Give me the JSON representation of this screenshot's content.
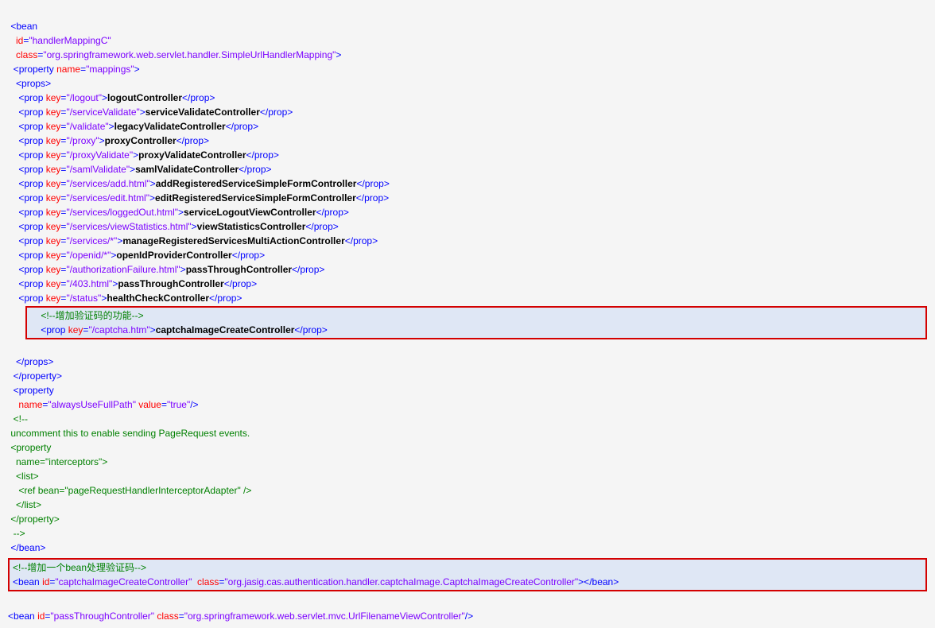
{
  "bean1": {
    "tag": "bean",
    "idAttr": "id",
    "idVal": "\"handlerMappingC\"",
    "classAttr": "class",
    "classVal": "\"org.springframework.web.servlet.handler.SimpleUrlHandlerMapping\""
  },
  "prop1": {
    "tag": "property",
    "nameAttr": "name",
    "nameVal": "\"mappings\""
  },
  "propsTag": "props",
  "props": [
    {
      "key": "\"/logout\"",
      "val": "logoutController"
    },
    {
      "key": "\"/serviceValidate\"",
      "val": "serviceValidateController"
    },
    {
      "key": "\"/validate\"",
      "val": "legacyValidateController"
    },
    {
      "key": "\"/proxy\"",
      "val": "proxyController"
    },
    {
      "key": "\"/proxyValidate\"",
      "val": "proxyValidateController"
    },
    {
      "key": "\"/samlValidate\"",
      "val": "samlValidateController"
    },
    {
      "key": "\"/services/add.html\"",
      "val": "addRegisteredServiceSimpleFormController"
    },
    {
      "key": "\"/services/edit.html\"",
      "val": "editRegisteredServiceSimpleFormController"
    },
    {
      "key": "\"/services/loggedOut.html\"",
      "val": "serviceLogoutViewController"
    },
    {
      "key": "\"/services/viewStatistics.html\"",
      "val": "viewStatisticsController"
    },
    {
      "key": "\"/services/*\"",
      "val": "manageRegisteredServicesMultiActionController"
    },
    {
      "key": "\"/openid/*\"",
      "val": "openIdProviderController"
    },
    {
      "key": "\"/authorizationFailure.html\"",
      "val": "passThroughController"
    },
    {
      "key": "\"/403.html\"",
      "val": "passThroughController"
    },
    {
      "key": "\"/status\"",
      "val": "healthCheckController"
    }
  ],
  "hl1": {
    "comment": "<!--增加验证码的功能-->",
    "key": "\"/captcha.htm\"",
    "val": "captchaImageCreateController"
  },
  "prop2": {
    "nameAttr": "name",
    "nameVal": "\"alwaysUseFullPath\"",
    "valueAttr": "value",
    "valueVal": "\"true\""
  },
  "commentBlock": {
    "open": "<!--",
    "l1": "uncomment this to enable sending PageRequest events.",
    "l2": "<property",
    "l3": "  name=\"interceptors\">",
    "l4": "  <list>",
    "l5": "   <ref bean=\"pageRequestHandlerInterceptorAdapter\" />",
    "l6": "  </list>",
    "l7": "</property>",
    "close": " -->"
  },
  "hl2": {
    "comment": "<!--增加一个bean处理验证码-->",
    "idAttr": "id",
    "idVal": "\"captchaImageCreateController\"",
    "classAttr": "class",
    "classVal": "\"org.jasig.cas.authentication.handler.captchaImage.CaptchaImageCreateController\""
  },
  "bean3": {
    "idAttr": "id",
    "idVal": "\"passThroughController\"",
    "classAttr": "class",
    "classVal": "\"org.springframework.web.servlet.mvc.UrlFilenameViewController\""
  },
  "lt": "<",
  "gt": ">",
  "ltc": "</",
  "sp": " ",
  "eq": "=",
  "propTag": "prop",
  "keyAttr": "key",
  "propertyTag": "property",
  "beanTag": "bean",
  "selfClose": "/>",
  "closeBean": "></",
  "beanEnd": ">"
}
